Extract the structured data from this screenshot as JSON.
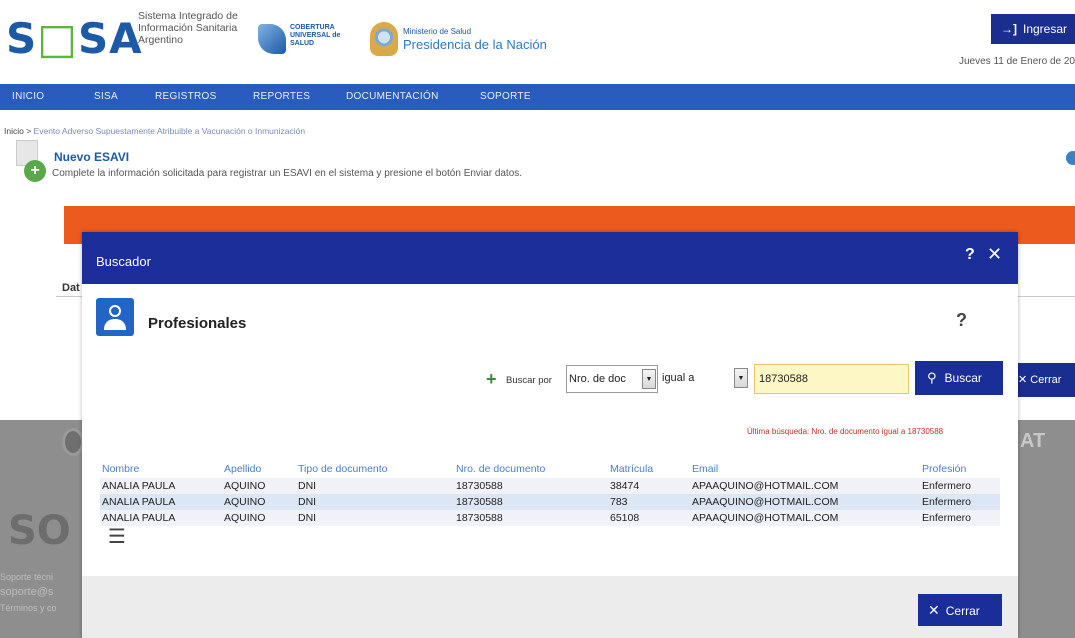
{
  "header": {
    "logo_text_1": "S",
    "logo_text_dot": "",
    "logo_text_2": "SA",
    "logo_sub": "Sistema Integrado de Información Sanitaria Argentino",
    "cobertura_text": "COBERTURA UNIVERSAL de SALUD",
    "ministerio_small": "Ministerio de Salud",
    "ministerio_main": "Presidencia de la Nación",
    "ingresar_label": "Ingresar",
    "date_text": "Jueves 11 de Enero de 20"
  },
  "nav": {
    "items": [
      "INICIO",
      "SISA",
      "REGISTROS",
      "REPORTES",
      "DOCUMENTACIÓN",
      "SOPORTE"
    ]
  },
  "page": {
    "breadcrumb_home": "Inicio >",
    "breadcrumb_current": "Evento Adverso Supuestamente Atribuible a Vacunación o Inmunización",
    "title": "Nuevo ESAVI",
    "description": "Complete la información solicitada para registrar un ESAVI en el sistema y presione el botón Enviar datos.",
    "section_label": "Dat",
    "right_cerrar_label": "Cerrar",
    "sat_text": "AT",
    "footer_sisa": "SO",
    "footer_line_1": "Soporte técni",
    "footer_line_2": "soporte@s",
    "footer_line_3": "Términos y co"
  },
  "modal": {
    "title": "Buscador",
    "help_label": "?",
    "close_label": "✕",
    "section_title": "Profesionales",
    "section_help": "?",
    "search": {
      "buscar_por_label": "Buscar por",
      "field_value": "Nro. de doc",
      "operator_value": "igual a",
      "query_value": "18730588",
      "buscar_label": "Buscar",
      "last_search": "Última búsqueda: Nro. de documento igual a 18730588"
    },
    "table": {
      "headers": [
        "Nombre",
        "Apellido",
        "Tipo de documento",
        "Nro. de documento",
        "Matrícula",
        "Email",
        "Profesión"
      ],
      "rows": [
        [
          "ANALIA PAULA",
          "AQUINO",
          "DNI",
          "18730588",
          "38474",
          "APAAQUINO@HOTMAIL.COM",
          "Enfermero"
        ],
        [
          "ANALIA PAULA",
          "AQUINO",
          "DNI",
          "18730588",
          "783",
          "APAAQUINO@HOTMAIL.COM",
          "Enfermero"
        ],
        [
          "ANALIA PAULA",
          "AQUINO",
          "DNI",
          "18730588",
          "65108",
          "APAAQUINO@HOTMAIL.COM",
          "Enfermero"
        ]
      ]
    },
    "cerrar_label": "Cerrar"
  },
  "icons": {
    "login": "login-icon",
    "search": "search-icon",
    "close": "close-icon",
    "menu": "hamburger-menu-icon",
    "add": "plus-icon",
    "professional": "doctor-icon"
  },
  "colors": {
    "brand_blue": "#1c5aa8",
    "nav_blue": "#2a5cc0",
    "modal_header": "#1b2e99",
    "accent_orange": "#ec5a1e",
    "error_red": "#c0302a"
  }
}
